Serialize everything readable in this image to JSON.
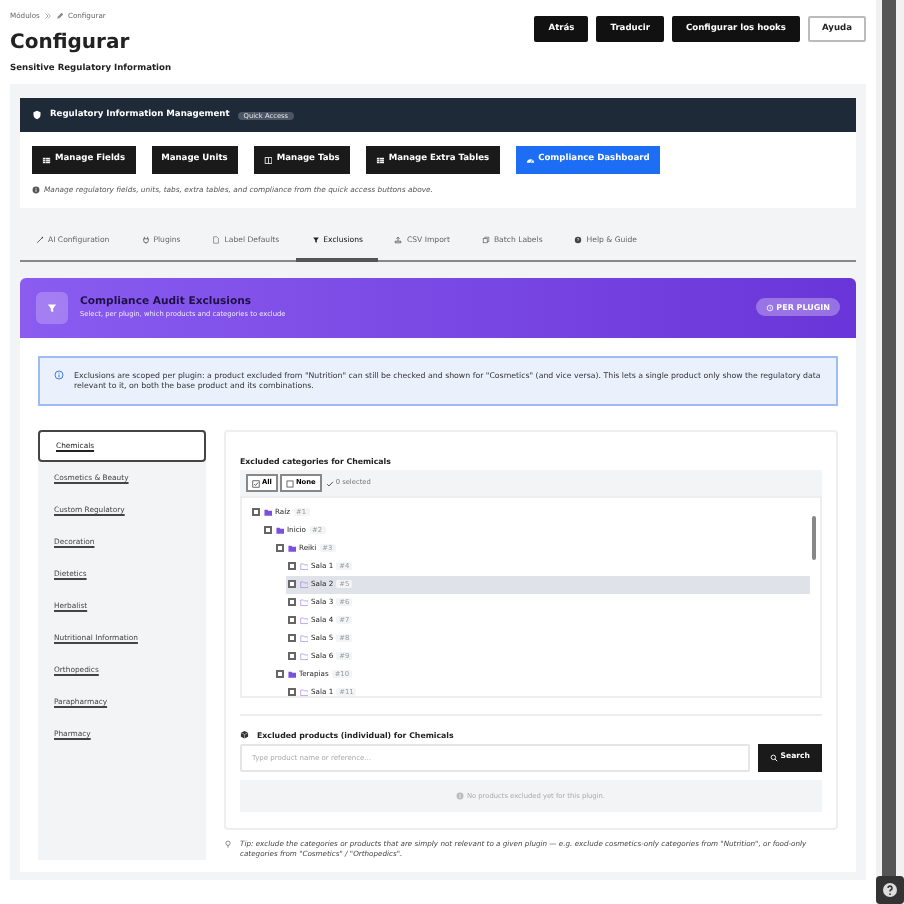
{
  "breadcrumb": [
    {
      "label": "Módulos"
    },
    {
      "label": "Configurar"
    }
  ],
  "page": {
    "title": "Configurar",
    "subtitle": "Sensitive Regulatory Information"
  },
  "header_buttons": [
    {
      "label": "Atrás",
      "kind": "dark"
    },
    {
      "label": "Traducir",
      "kind": "dark"
    },
    {
      "label": "Configurar los hooks",
      "kind": "dark"
    },
    {
      "label": "Ayuda",
      "kind": "outline"
    }
  ],
  "module_panel": {
    "title": "Regulatory Information Management",
    "badge": "Quick Access",
    "buttons": [
      {
        "label": "Manage Fields",
        "kind": "dark"
      },
      {
        "label": "Manage Units",
        "kind": "dark"
      },
      {
        "label": "Manage Tabs",
        "kind": "dark"
      },
      {
        "label": "Manage Extra Tables",
        "kind": "dark"
      },
      {
        "label": "Compliance Dashboard",
        "kind": "primary"
      }
    ],
    "note": "Manage regulatory fields, units, tabs, extra tables, and compliance from the quick access buttons above."
  },
  "tabs": [
    {
      "label": "AI Configuration",
      "selected": false
    },
    {
      "label": "Plugins",
      "selected": false
    },
    {
      "label": "Label Defaults",
      "selected": false
    },
    {
      "label": "Exclusions",
      "selected": true
    },
    {
      "label": "CSV Import",
      "selected": false
    },
    {
      "label": "Batch Labels",
      "selected": false
    },
    {
      "label": "Help & Guide",
      "selected": false
    }
  ],
  "exclusions_header": {
    "title": "Compliance Audit Exclusions",
    "subtitle": "Select, per plugin, which products and categories to exclude",
    "badge": "PER PLUGIN"
  },
  "info": "Exclusions are scoped per plugin: a product excluded from \"Nutrition\" can still be checked and shown for \"Cosmetics\" (and vice versa). This lets a single product only show the regulatory data relevant to it, on both the base product and its combinations.",
  "plugins": [
    {
      "label": "Chemicals",
      "selected": true
    },
    {
      "label": "Cosmetics & Beauty",
      "selected": false
    },
    {
      "label": "Custom Regulatory",
      "selected": false
    },
    {
      "label": "Decoration",
      "selected": false
    },
    {
      "label": "Dietetics",
      "selected": false
    },
    {
      "label": "Herbalist",
      "selected": false
    },
    {
      "label": "Nutritional Information",
      "selected": false
    },
    {
      "label": "Orthopedics",
      "selected": false
    },
    {
      "label": "Parapharmacy",
      "selected": false
    },
    {
      "label": "Pharmacy",
      "selected": false
    }
  ],
  "categories": {
    "title": "Excluded categories for Chemicals",
    "all": "All",
    "none": "None",
    "selected_count": "0 selected",
    "tree": [
      {
        "label": "Raíz",
        "count": "#1",
        "checked": false,
        "highlighted": false,
        "children": [
          {
            "label": "Inicio",
            "count": "#2",
            "checked": false,
            "highlighted": false,
            "children": [
              {
                "label": "Reiki",
                "count": "#3",
                "checked": false,
                "highlighted": false,
                "children": [
                  {
                    "label": "Sala 1",
                    "count": "#4",
                    "checked": false,
                    "highlighted": false
                  },
                  {
                    "label": "Sala 2",
                    "count": "#5",
                    "checked": false,
                    "highlighted": true
                  },
                  {
                    "label": "Sala 3",
                    "count": "#6",
                    "checked": false,
                    "highlighted": false
                  },
                  {
                    "label": "Sala 4",
                    "count": "#7",
                    "checked": false,
                    "highlighted": false
                  },
                  {
                    "label": "Sala 5",
                    "count": "#8",
                    "checked": false,
                    "highlighted": false
                  },
                  {
                    "label": "Sala 6",
                    "count": "#9",
                    "checked": false,
                    "highlighted": false
                  }
                ]
              },
              {
                "label": "Terapias",
                "count": "#10",
                "checked": false,
                "highlighted": false,
                "children": [
                  {
                    "label": "Sala 1",
                    "count": "#11",
                    "checked": false,
                    "highlighted": false
                  }
                ]
              }
            ]
          }
        ]
      }
    ]
  },
  "products": {
    "title": "Excluded products (individual) for Chemicals",
    "placeholder": "Type product name or reference...",
    "button": "Search",
    "empty": "No products excluded yet for this plugin."
  },
  "tip": "Tip: exclude the categories or products that are simply not relevant to a given plugin — e.g. exclude cosmetics-only categories from \"Nutrition\", or food-only categories from \"Cosmetics\" / \"Orthopedics\"."
}
